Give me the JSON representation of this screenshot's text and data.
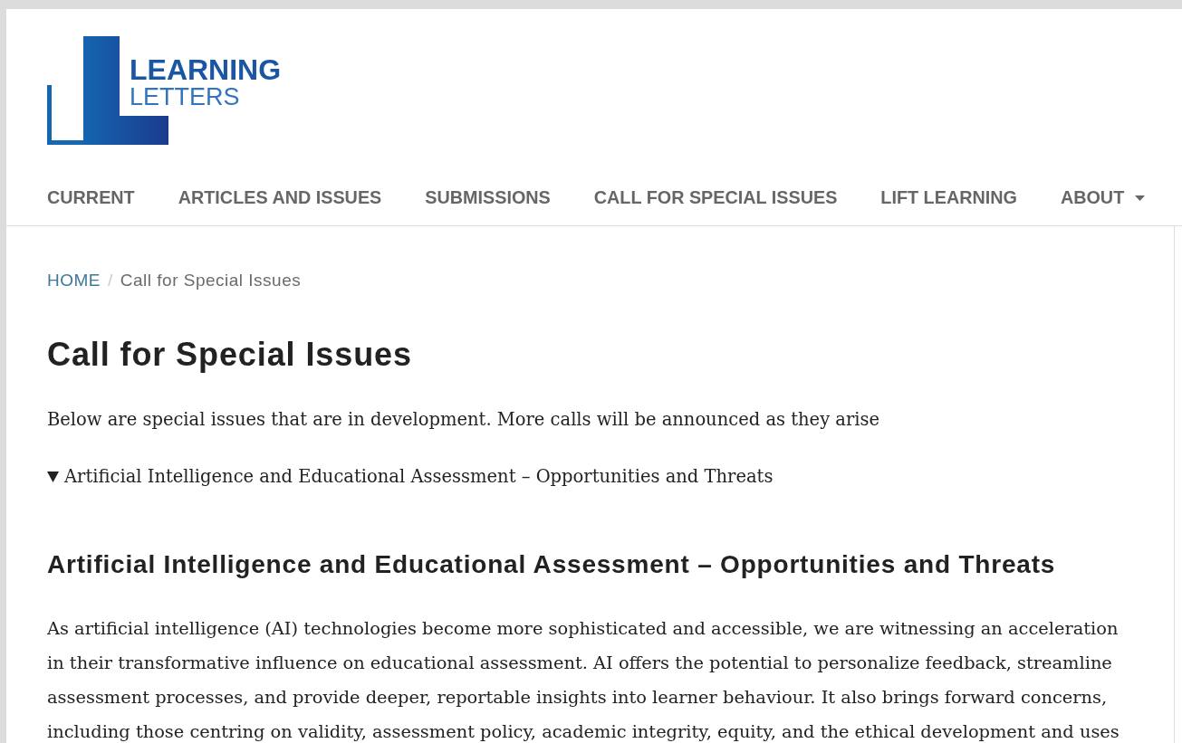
{
  "header": {
    "logo": {
      "title": "LEARNING",
      "subtitle": "LETTERS"
    }
  },
  "nav": {
    "items": [
      {
        "label": "CURRENT",
        "dropdown": false
      },
      {
        "label": "ARTICLES AND ISSUES",
        "dropdown": false
      },
      {
        "label": "SUBMISSIONS",
        "dropdown": false
      },
      {
        "label": "CALL FOR SPECIAL ISSUES",
        "dropdown": false
      },
      {
        "label": "LIFT LEARNING",
        "dropdown": false
      },
      {
        "label": "ABOUT",
        "dropdown": true
      }
    ]
  },
  "breadcrumb": {
    "separator": "/",
    "items": [
      {
        "label": "HOME",
        "current": false
      },
      {
        "label": "Call for Special Issues",
        "current": true
      }
    ]
  },
  "page": {
    "title": "Call for Special Issues",
    "intro": "Below are special issues that are in development. More calls will be announced as they arise",
    "details": {
      "summary": "Artificial Intelligence and Educational Assessment – Opportunities and Threats",
      "expanded": true
    },
    "section": {
      "heading": "Artificial Intelligence and Educational Assessment – Opportunities and Threats",
      "paragraph": "As artificial intelligence (AI) technologies become more sophisticated and accessible, we are witnessing an acceleration in their transformative influence on educational assessment. AI offers the potential to personalize feedback, streamline assessment processes, and provide deeper, reportable insights into learner behaviour. It also brings forward concerns, including those centring on validity, assessment policy, academic integrity, equity, and the ethical development and uses"
    }
  }
}
